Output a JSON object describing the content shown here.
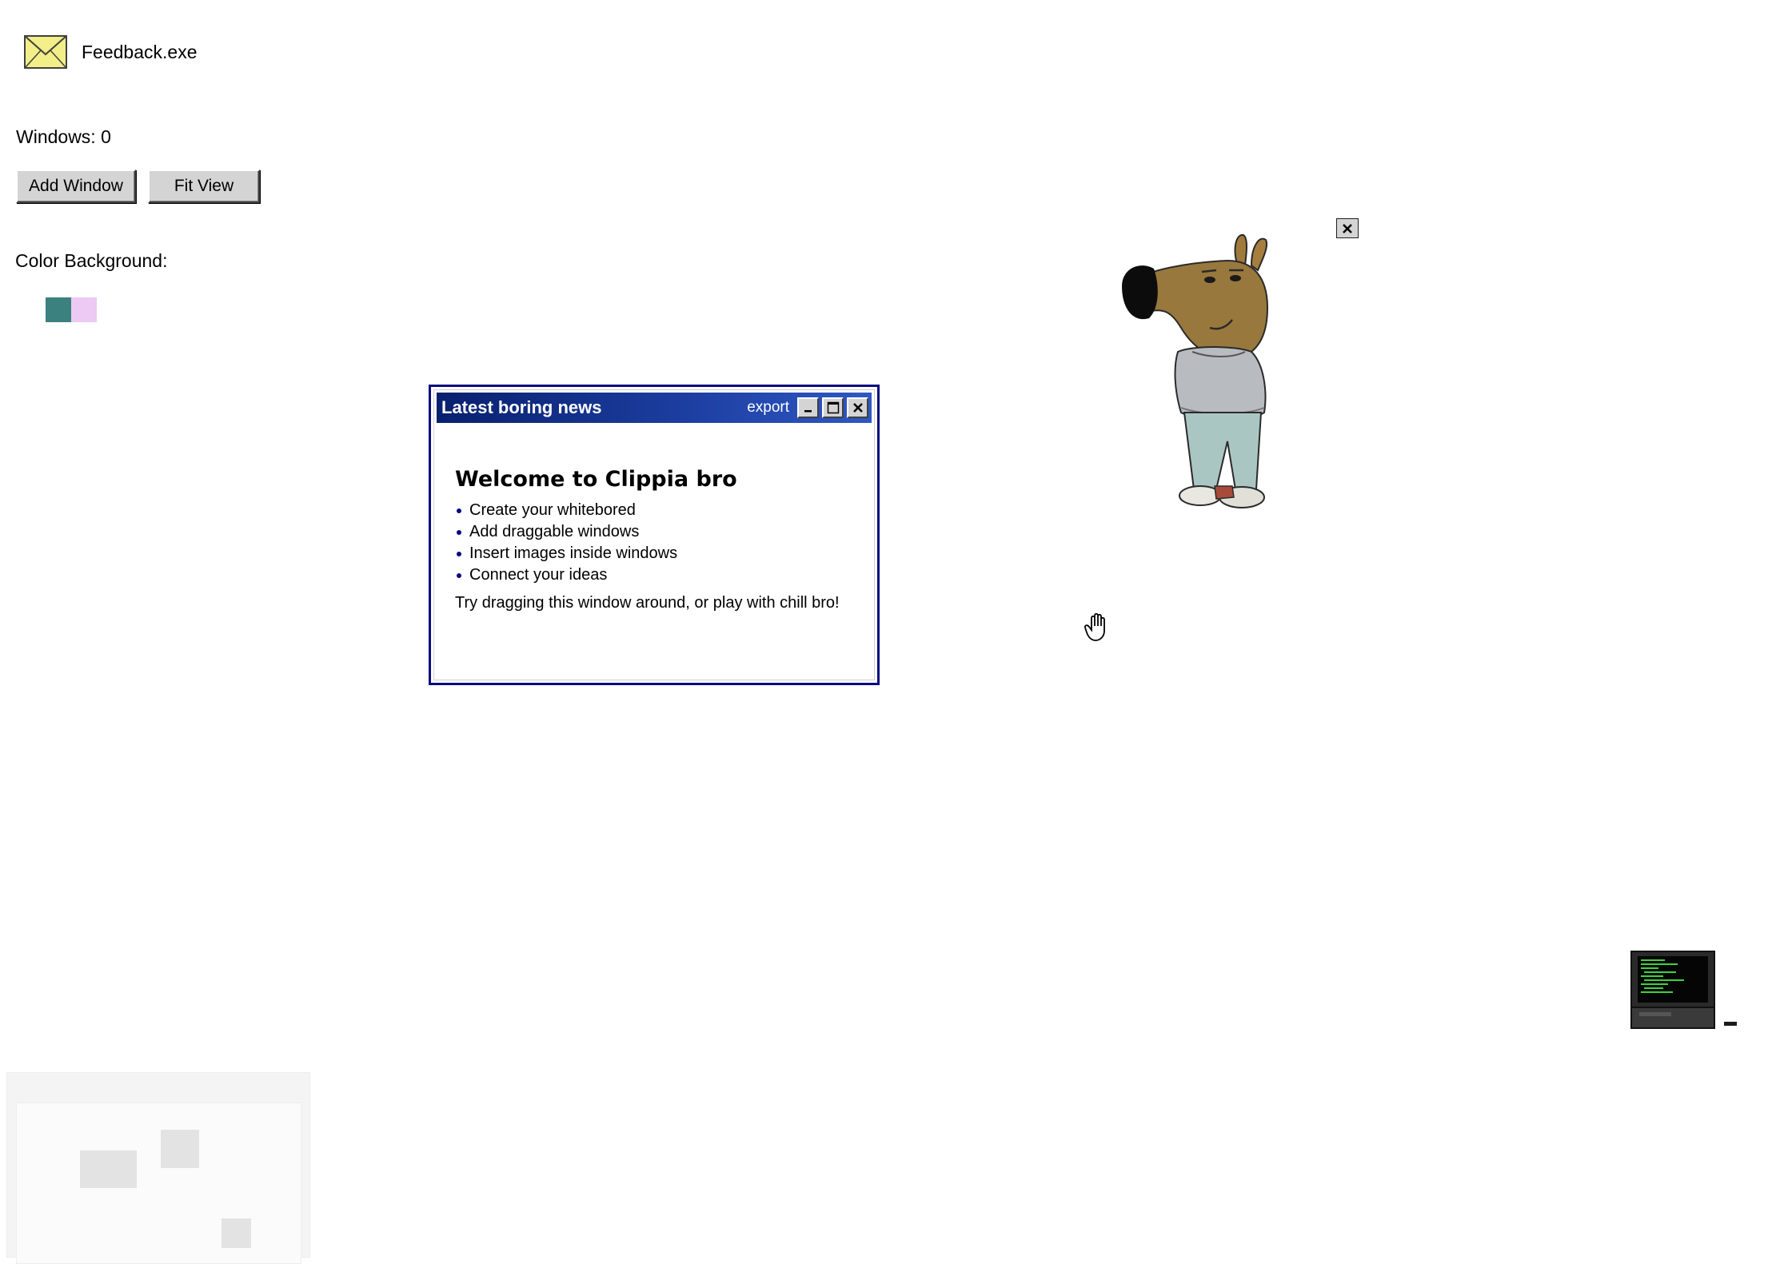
{
  "desktop_icon": {
    "label": "Feedback.exe",
    "icon": "envelope-icon"
  },
  "toolbar": {
    "windows_label": "Windows: 0",
    "add_window_label": "Add Window",
    "fit_view_label": "Fit View"
  },
  "background_picker": {
    "label": "Color Background:",
    "swatches": [
      "#3a8180",
      "#eccaf3"
    ]
  },
  "news_window": {
    "title": "Latest boring news",
    "export_label": "export",
    "heading": "Welcome to Clippia bro",
    "items": [
      "Create your whitebored",
      "Add draggable windows",
      "Insert images inside windows",
      "Connect your ideas"
    ],
    "footer": "Try dragging this window around, or play with chill bro!"
  },
  "mascot": {
    "close_icon": "close-icon",
    "icon": "chill-bro-mascot"
  },
  "cursor": {
    "icon": "grab-hand-icon"
  },
  "terminal": {
    "icon": "terminal-computer-icon"
  },
  "minimap": {
    "icon": "minimap"
  }
}
